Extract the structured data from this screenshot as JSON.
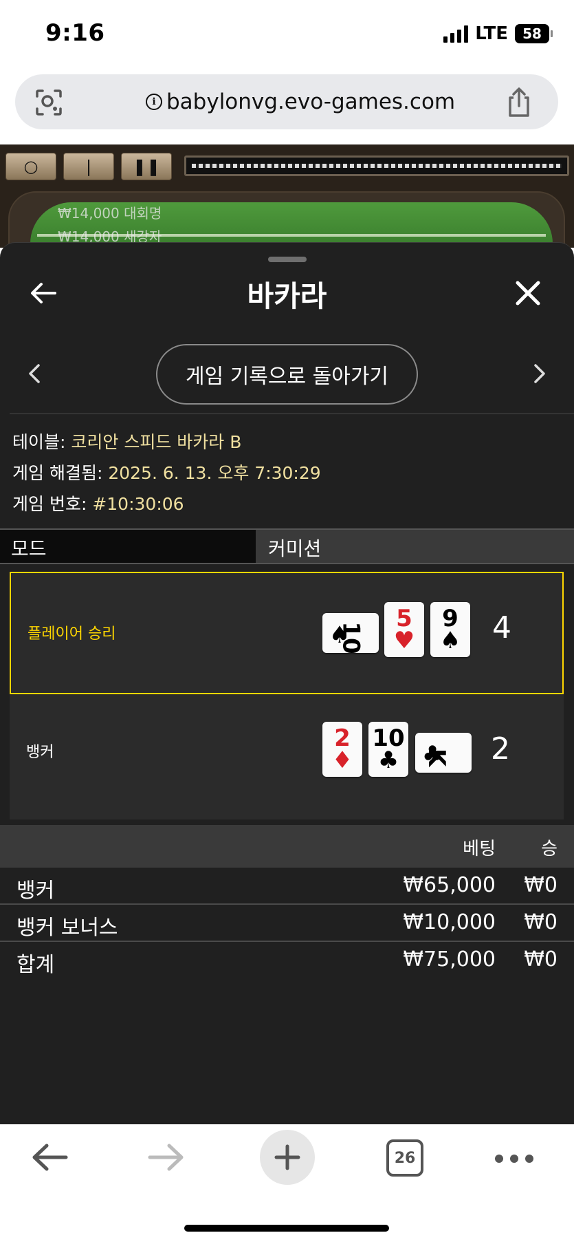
{
  "status_bar": {
    "time": "9:16",
    "network": "LTE",
    "battery": "58"
  },
  "browser": {
    "url": "babylonvg.evo-games.com",
    "tab_count": "26"
  },
  "background": {
    "ticker": [
      {
        "amount": "₩14,000",
        "name": "대회명"
      },
      {
        "amount": "₩14,000",
        "name": "새강자"
      }
    ]
  },
  "modal": {
    "title": "바카라",
    "history_button": "게임 기록으로 돌아가기",
    "info": {
      "table_label": "테이블:",
      "table_value": "코리안 스피드 바카라 B",
      "resolved_label": "게임 해결됨:",
      "resolved_value": "2025. 6. 13. 오후 7:30:29",
      "game_no_label": "게임 번호:",
      "game_no_value": "#10:30:06"
    },
    "mode": {
      "label": "모드",
      "value": "커미션"
    },
    "hands": [
      {
        "label": "플레이어 승리",
        "winner": true,
        "score": "4",
        "cards": [
          {
            "rank": "10",
            "suit": "♠",
            "color": "black",
            "sideways": true
          },
          {
            "rank": "5",
            "suit": "♥",
            "color": "red",
            "sideways": false
          },
          {
            "rank": "9",
            "suit": "♠",
            "color": "black",
            "sideways": false
          }
        ]
      },
      {
        "label": "뱅커",
        "winner": false,
        "score": "2",
        "cards": [
          {
            "rank": "2",
            "suit": "♦",
            "color": "red",
            "sideways": false
          },
          {
            "rank": "10",
            "suit": "♣",
            "color": "black",
            "sideways": false
          },
          {
            "rank": "K",
            "suit": "♣",
            "color": "black",
            "sideways": true
          }
        ]
      }
    ],
    "bets": {
      "header_bet": "베팅",
      "header_win": "승",
      "rows": [
        {
          "name": "뱅커",
          "amount": "₩65,000",
          "win": "₩0"
        },
        {
          "name": "뱅커 보너스",
          "amount": "₩10,000",
          "win": "₩0"
        }
      ],
      "total": {
        "name": "합계",
        "amount": "₩75,000",
        "win": "₩0"
      }
    }
  },
  "colors": {
    "winner_border": "#ffd700",
    "winner_text": "#ffd700",
    "sheet_bg": "#202020",
    "red_suit": "#d8222a"
  }
}
